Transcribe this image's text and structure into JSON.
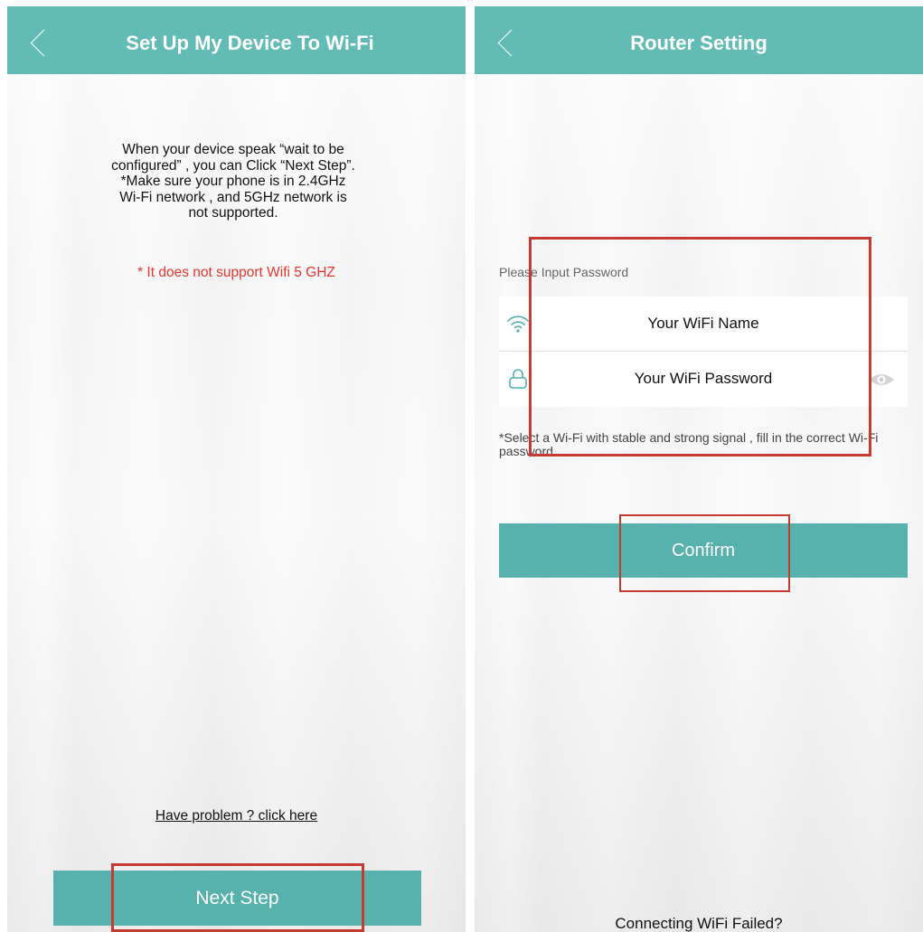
{
  "setup_screen": {
    "title": "Set Up My Device To Wi-Fi",
    "instructions": [
      "When your device speak “wait to be",
      "configured” , you can Click “Next Step”.",
      "*Make sure your phone is in 2.4GHz",
      "Wi-Fi network , and 5GHz network is",
      "not supported."
    ],
    "warning": "* It does not support Wifi 5 GHZ",
    "problem_link": "Have problem ? click here",
    "next_button": "Next Step",
    "icons": {
      "back": "chevron-left-icon"
    }
  },
  "router_screen": {
    "title": "Router Setting",
    "prompt": "Please Input Password",
    "wifi_name": "Your WiFi Name",
    "wifi_password": "Your WiFi Password",
    "hint": "*Select a Wi-Fi with stable and strong signal , fill in the correct Wi-Fi password .",
    "confirm_button": "Confirm",
    "failed_link": "Connecting WiFi Failed?",
    "icons": {
      "back": "chevron-left-icon",
      "wifi": "wifi-icon",
      "lock": "lock-icon",
      "visibility": "eye-icon"
    }
  },
  "colors": {
    "header": "#62bcb5",
    "button": "#57b2ad",
    "accent_icon": "#4fb3ad",
    "warning": "#e8362f",
    "highlight_box": "#c53a31"
  }
}
